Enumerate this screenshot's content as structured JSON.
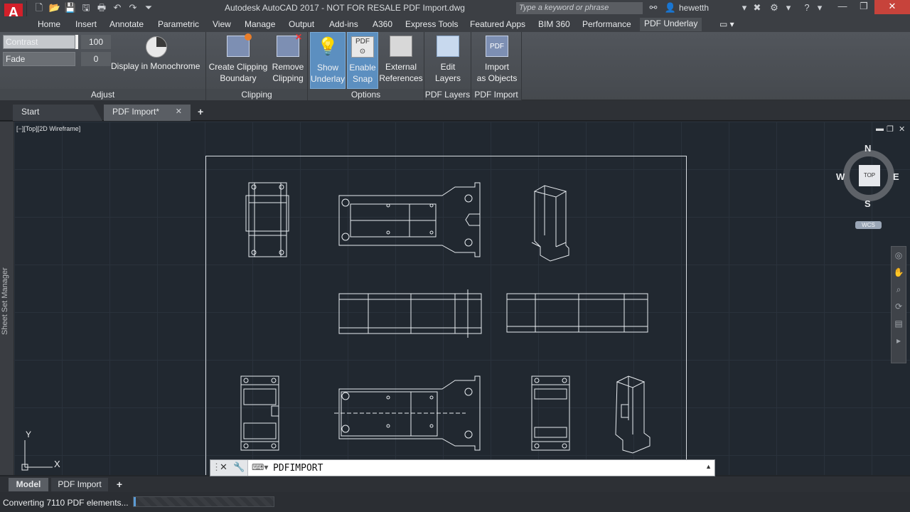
{
  "app": {
    "logo_letter": "A",
    "title": "Autodesk AutoCAD 2017 - NOT FOR RESALE    PDF Import.dwg",
    "search_placeholder": "Type a keyword or phrase",
    "user": "hewetth"
  },
  "ribbon_tabs": [
    "Home",
    "Insert",
    "Annotate",
    "Parametric",
    "View",
    "Manage",
    "Output",
    "Add-ins",
    "A360",
    "Express Tools",
    "Featured Apps",
    "BIM 360",
    "Performance",
    "PDF Underlay"
  ],
  "ribbon_active_tab": "PDF Underlay",
  "ribbon": {
    "adjust": {
      "title": "Adjust",
      "contrast_label": "Contrast",
      "contrast_value": "100",
      "fade_label": "Fade",
      "fade_value": "0",
      "monochrome_label": "Display in Monochrome"
    },
    "clipping": {
      "title": "Clipping",
      "create_line1": "Create Clipping",
      "create_line2": "Boundary",
      "remove_line1": "Remove",
      "remove_line2": "Clipping"
    },
    "options": {
      "title": "Options",
      "show_line1": "Show",
      "show_line2": "Underlay",
      "snap_line1": "Enable",
      "snap_line2": "Snap",
      "ext_line1": "External",
      "ext_line2": "References"
    },
    "pdf_layers": {
      "title": "PDF Layers",
      "edit_line1": "Edit",
      "edit_line2": "Layers"
    },
    "pdf_import": {
      "title": "PDF Import",
      "import_line1": "Import",
      "import_line2": "as Objects",
      "icon_text": "PDF"
    }
  },
  "doc_tabs": {
    "start": "Start",
    "current": "PDF Import*"
  },
  "viewport": {
    "label": "[−][Top][2D Wireframe]",
    "sheet_set_manager": "Sheet Set Manager"
  },
  "viewcube": {
    "top": "TOP",
    "north": "N",
    "south": "S",
    "east": "E",
    "west": "W",
    "wcs": "WCS"
  },
  "ucs": {
    "x": "X",
    "y": "Y"
  },
  "command": {
    "text": "PDFIMPORT"
  },
  "layout_tabs": {
    "model": "Model",
    "layout1": "PDF Import",
    "add": "+"
  },
  "status": {
    "text": "Converting 7110 PDF elements...",
    "progress_fraction": 0.01
  },
  "colors": {
    "accent": "#5c8fc0",
    "canvas": "#212830",
    "close_button": "#c7433b"
  }
}
